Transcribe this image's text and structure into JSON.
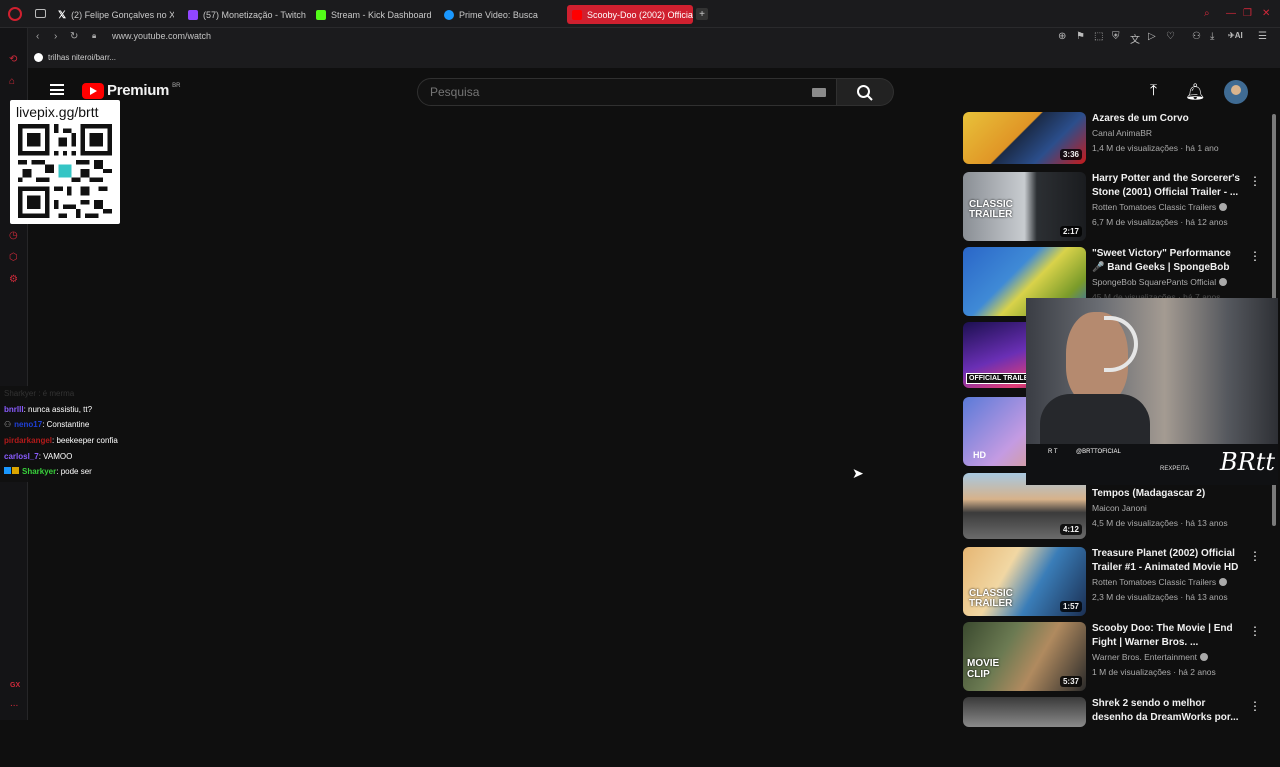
{
  "tabs": [
    {
      "label": "(2) Felipe Gonçalves no X",
      "icon": "x-icon"
    },
    {
      "label": "(57) Monetização - Twitch",
      "icon": "twitch-icon"
    },
    {
      "label": "Stream - Kick Dashboard",
      "icon": "kick-icon"
    },
    {
      "label": "Prime Video: Busca",
      "icon": "prime-icon"
    },
    {
      "label": "Scooby-Doo (2002) Officia",
      "icon": "youtube-icon"
    }
  ],
  "address": {
    "url": "www.youtube.com/watch",
    "ai_label": "AI"
  },
  "bookmarks": [
    {
      "label": "trilhas niteroi/barr..."
    }
  ],
  "sidebar": {
    "gx_label": "GX",
    "more_label": "..."
  },
  "youtube": {
    "logo_text": "Premium",
    "region": "BR",
    "search_placeholder": "Pesquisa"
  },
  "overlay": {
    "qr_label": "livepix.gg/brtt"
  },
  "chat": {
    "faded": "Sharkyer : é merma",
    "messages": [
      {
        "user": "bnrlll",
        "text": ": nunca assistiu, tt?",
        "color": "#8a5cff"
      },
      {
        "user": "neno17",
        "text": ": Constantine",
        "color": "#1f3fd6"
      },
      {
        "user": "pirdarkangel",
        "text": ": beekeeper confia",
        "color": "#b21a1a"
      },
      {
        "user": "carlosl_7",
        "text": ": VAMOO",
        "color": "#8a5cff"
      },
      {
        "user": "Sharkyer",
        "text": ": pode ser",
        "color": "#38d13b"
      }
    ]
  },
  "related": [
    {
      "title": "Azares de um Corvo",
      "channel": "Canal AnimaBR",
      "meta": "1,4 M de visualizações · há 1 ano",
      "duration": "3:36",
      "verified": false
    },
    {
      "title": "Harry Potter and the Sorcerer's Stone (2001) Official Trailer - ...",
      "channel": "Rotten Tomatoes Classic Trailers",
      "meta": "6,7 M de visualizações · há 12 anos",
      "duration": "2:17",
      "verified": true,
      "thumb_text": "CLASSIC TRAILER"
    },
    {
      "title": "\"Sweet Victory\" Performance 🎤 Band Geeks | SpongeBob",
      "channel": "SpongeBob SquarePants Official",
      "meta": "45 M de visualizações · há 7 anos",
      "duration": "",
      "verified": true
    },
    {
      "title": "",
      "channel": "",
      "meta": "",
      "duration": "",
      "verified": false,
      "thumb_text": "OFFICIAL TRAILER"
    },
    {
      "title": "",
      "channel": "",
      "meta": "",
      "duration": "",
      "verified": false,
      "thumb_text": "HD"
    },
    {
      "title": "Tempos (Madagascar 2)",
      "channel": "Maicon Janoni",
      "meta": "4,5 M de visualizações · há 13 anos",
      "duration": "4:12",
      "verified": false
    },
    {
      "title": "Treasure Planet (2002) Official Trailer #1 - Animated Movie HD",
      "channel": "Rotten Tomatoes Classic Trailers",
      "meta": "2,3 M de visualizações · há 13 anos",
      "duration": "1:57",
      "verified": true,
      "thumb_text": "CLASSIC TRAILER"
    },
    {
      "title": "Scooby Doo: The Movie | End Fight | Warner Bros. ...",
      "channel": "Warner Bros. Entertainment",
      "meta": "1 M de visualizações · há 2 anos",
      "duration": "5:37",
      "verified": true,
      "thumb_text": "MOVIE CLIP"
    },
    {
      "title": "Shrek 2 sendo o melhor desenho da DreamWorks por...",
      "channel": "",
      "meta": "",
      "duration": "",
      "verified": false
    }
  ],
  "webcam": {
    "handle": "@BRTTOFICIAL",
    "logo": "BRtt",
    "letters": "R T",
    "sponsor": "REXPEITA"
  },
  "colors": {
    "accent": "#d0202f",
    "youtube_red": "#ff0000",
    "bg": "#0f0f0f"
  }
}
